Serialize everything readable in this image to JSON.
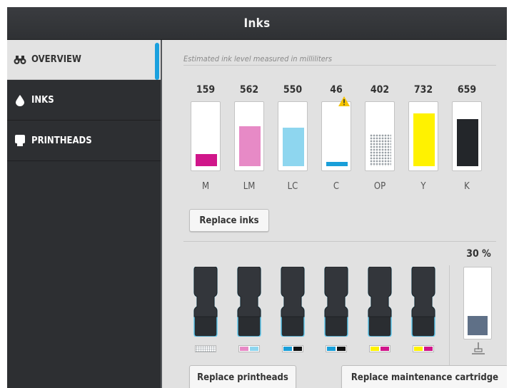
{
  "window": {
    "title": "Inks"
  },
  "sidebar": {
    "items": [
      {
        "label": "OVERVIEW",
        "icon": "binoculars-icon"
      },
      {
        "label": "INKS",
        "icon": "ink-drop-icon"
      },
      {
        "label": "PRINTHEADS",
        "icon": "printhead-icon"
      }
    ]
  },
  "main": {
    "caption": "Estimated ink level measured in milliliters",
    "inks": [
      {
        "label": "M",
        "value": "159",
        "fill": 0.2,
        "color": "#d0168a"
      },
      {
        "label": "LM",
        "value": "562",
        "fill": 0.67,
        "color": "#e78ac6"
      },
      {
        "label": "LC",
        "value": "550",
        "fill": 0.64,
        "color": "#8ed6ef"
      },
      {
        "label": "C",
        "value": "46",
        "fill": 0.07,
        "color": "#1a9fd9",
        "warning": true
      },
      {
        "label": "OP",
        "value": "402",
        "fill": 0.54,
        "color": "dotted"
      },
      {
        "label": "Y",
        "value": "732",
        "fill": 0.88,
        "color": "#fff200"
      },
      {
        "label": "K",
        "value": "659",
        "fill": 0.78,
        "color": "#23262a"
      }
    ],
    "replace_inks_label": "Replace inks",
    "maintenance_percent": "30 %",
    "maintenance_fill": 0.3,
    "printheads": [
      {
        "colors": [
          "dotted"
        ]
      },
      {
        "colors": [
          "#e78ac6",
          "#8ed6ef"
        ]
      },
      {
        "colors": [
          "#1a9fd9",
          "#111111"
        ]
      },
      {
        "colors": [
          "#1a9fd9",
          "#111111"
        ]
      },
      {
        "colors": [
          "#fff200",
          "#d0168a"
        ]
      },
      {
        "colors": [
          "#fff200",
          "#d0168a"
        ]
      }
    ],
    "replace_printheads_label": "Replace printheads",
    "replace_maintenance_label": "Replace maintenance cartridge"
  }
}
